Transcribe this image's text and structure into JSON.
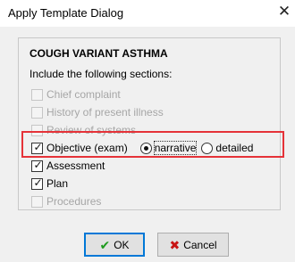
{
  "window": {
    "title": "Apply Template Dialog",
    "close_icon": "close-icon"
  },
  "template": {
    "name": "COUGH VARIANT ASTHMA",
    "instruction": "Include the following sections:"
  },
  "sections": [
    {
      "label": "Chief complaint",
      "checked": false,
      "enabled": false
    },
    {
      "label": "History of present illness",
      "checked": false,
      "enabled": false
    },
    {
      "label": "Review of systems",
      "checked": false,
      "enabled": false
    },
    {
      "label": "Objective (exam)",
      "checked": true,
      "enabled": true
    },
    {
      "label": "Assessment",
      "checked": true,
      "enabled": true
    },
    {
      "label": "Plan",
      "checked": true,
      "enabled": true
    },
    {
      "label": "Procedures",
      "checked": false,
      "enabled": false
    }
  ],
  "objective_format": {
    "options": [
      "narrative",
      "detailed"
    ],
    "selected": "narrative"
  },
  "buttons": {
    "ok_label": "OK",
    "cancel_label": "Cancel"
  },
  "colors": {
    "highlight": "#e53238",
    "ok_icon": "#1e9b1e",
    "cancel_icon": "#c81414"
  }
}
